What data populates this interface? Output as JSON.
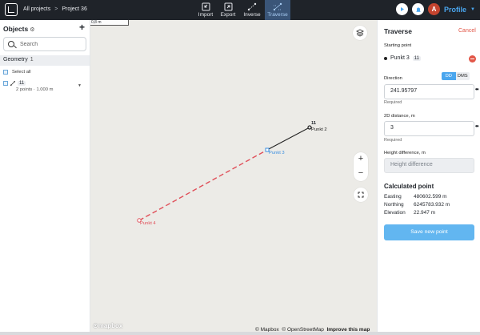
{
  "breadcrumb": {
    "root": "All projects",
    "sep": ">",
    "project": "Project 36"
  },
  "toolbar": {
    "tools": [
      {
        "label": "Import",
        "icon": "import-icon"
      },
      {
        "label": "Export",
        "icon": "export-icon"
      },
      {
        "label": "Inverse",
        "icon": "inverse-icon"
      },
      {
        "label": "Traverse",
        "icon": "traverse-icon",
        "active": true
      }
    ],
    "avatar_initial": "A",
    "profile_label": "Profile",
    "accent": "#4aa6ee"
  },
  "left": {
    "title": "Objects",
    "add_symbol": "+",
    "search_placeholder": "Search",
    "geometry": {
      "label": "Geometry",
      "count": "1"
    },
    "select_all": "Select all",
    "item": {
      "name": "11",
      "summary": "2 points · 1.000 m"
    }
  },
  "map": {
    "scale": "0,8 m",
    "points": [
      {
        "name": "11",
        "label": "Punkt 2",
        "color": "#222222"
      },
      {
        "name": "",
        "label": "Punkt 3",
        "color": "#3b8fe0"
      },
      {
        "name": "",
        "label": "Punkt 4",
        "color": "#e0505a"
      }
    ],
    "zoom_in": "+",
    "zoom_out": "−",
    "logo": "mapbox",
    "attribution": {
      "mapbox": "© Mapbox",
      "osm": "© OpenStreetMap",
      "improve": "Improve this map"
    }
  },
  "traverse": {
    "title": "Traverse",
    "cancel": "Cancel",
    "starting_point_label": "Starting point",
    "starting_point": {
      "name": "Punkt 3",
      "badge": "11"
    },
    "direction_label": "Direction",
    "mode_dd": "DD",
    "mode_dms": "DMS",
    "direction_value": "241.95797",
    "required": "Required",
    "distance_label": "2D distance, m",
    "distance_value": "3",
    "height_label": "Height difference, m",
    "height_placeholder": "Height difference",
    "calculated_title": "Calculated point",
    "easting_label": "Easting",
    "easting_value": "480602.599 m",
    "northing_label": "Northing",
    "northing_value": "6245783.932 m",
    "elevation_label": "Elevation",
    "elevation_value": "22.947 m",
    "save_label": "Save new point",
    "danger": "#e25748"
  }
}
